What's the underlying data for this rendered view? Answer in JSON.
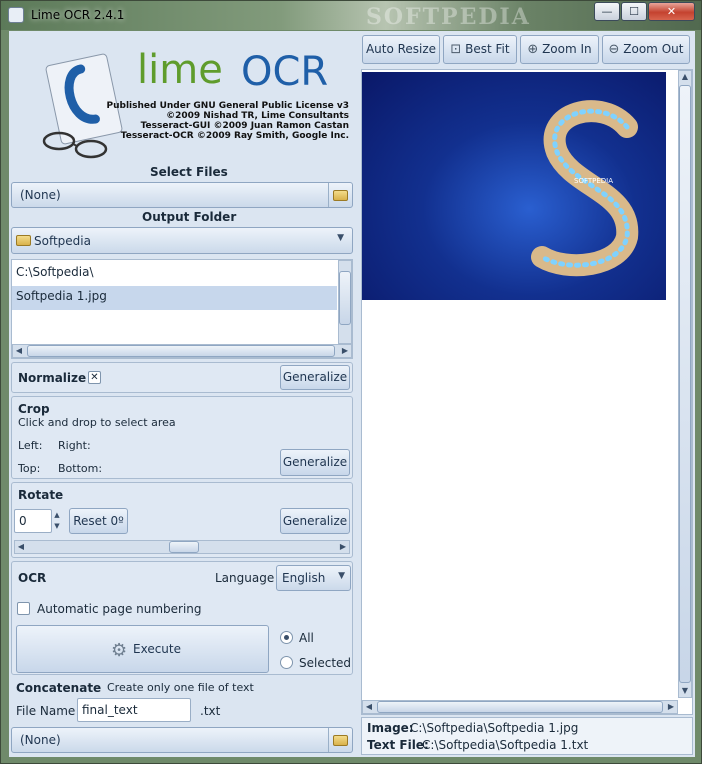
{
  "window": {
    "title": "Lime OCR 2.4.1",
    "watermark": "SOFTPEDIA",
    "controls": {
      "minimize": "—",
      "maximize": "☐",
      "close": "✕"
    }
  },
  "logo": {
    "lime": "lime",
    "ocr": "OCR",
    "license_lines": [
      "Published Under GNU General Public License v3",
      "©2009 Nishad TR, Lime Consultants",
      "Tesseract-GUI ©2009 Juan Ramon Castan",
      "Tesseract-OCR ©2009 Ray Smith, Google Inc."
    ]
  },
  "select_files": {
    "title": "Select Files",
    "value": "(None)"
  },
  "output_folder": {
    "title": "Output Folder",
    "value": "Softpedia",
    "list": [
      "C:\\Softpedia\\",
      "Softpedia 1.jpg"
    ],
    "selected_index": 1
  },
  "normalize": {
    "label": "Normalize",
    "checked_mark": "✕",
    "button": "Generalize"
  },
  "crop": {
    "title": "Crop",
    "hint": "Click and drop to select area",
    "left": "Left:",
    "right": "Right:",
    "top": "Top:",
    "bottom": "Bottom:",
    "button": "Generalize"
  },
  "rotate": {
    "title": "Rotate",
    "value": "0",
    "reset_button": "Reset 0º",
    "button": "Generalize"
  },
  "ocr": {
    "title": "OCR",
    "language_label": "Language",
    "language_value": "English",
    "auto_numbering": "Automatic page numbering",
    "execute": "Execute",
    "radio_all": "All",
    "radio_selected": "Selected"
  },
  "concatenate": {
    "title": "Concatenate",
    "hint": "Create only one file of text",
    "filename_label": "File Name",
    "filename_value": "final_text",
    "extension": ".txt",
    "value": "(None)"
  },
  "toolbar": {
    "auto_resize": "Auto Resize",
    "best_fit": "Best Fit",
    "zoom_in": "Zoom In",
    "zoom_out": "Zoom Out"
  },
  "preview": {
    "brand": "SOFTPEDIA"
  },
  "status": {
    "image_label": "Image:",
    "image_value": "C:\\Softpedia\\Softpedia 1.jpg",
    "text_label": "Text File:",
    "text_value": "C:\\Softpedia\\Softpedia 1.txt"
  },
  "colors": {
    "accent": "#5f9c2c",
    "logo_blue": "#1f5fa8",
    "preview_bg": "#0c1f7a"
  }
}
